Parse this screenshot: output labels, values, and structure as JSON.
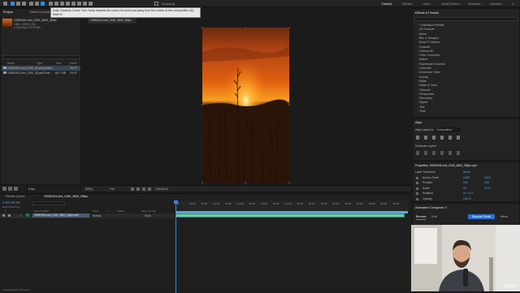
{
  "toolbar": {
    "tooltip": "Dolly Towards Cursor Tool: Dolly towards the cursor hit point and away from the center of the composition (D) Shift+D",
    "snapping_label": "Snapping",
    "workspaces": [
      "Default",
      "Review",
      "Learn",
      "Small Screen",
      "Standard",
      "Libraries"
    ]
  },
  "project": {
    "tabs": [
      "Project",
      "Effect Controls"
    ],
    "comp_name": "19082404-uhd_2160_3840_30fps",
    "info_lines": [
      "1080 x 1920 (1.00)",
      "∆ 0;00;38;14, 29.97 fps"
    ],
    "search_placeholder": "",
    "columns": [
      "Name",
      "Type",
      "Size",
      "Frame Ra"
    ],
    "items": [
      {
        "name": "19082404-uhd_2160_3840_30fps",
        "type": "Composition",
        "size": "",
        "rate": "29.97"
      },
      {
        "name": "19082404-uhd_2160_3840_30fps.mp4",
        "type": "QuickTime",
        "size": "66.7 MB",
        "rate": "29.97"
      }
    ],
    "footer_bpc": "8 bpc"
  },
  "viewer": {
    "tab_label": "19082404-uhd_2160_3840_30fps",
    "zoom": "(50%)",
    "quality": "Full",
    "timecode": "0;00;00;00"
  },
  "effects": {
    "title": "Effects & Presets",
    "search_placeholder": "",
    "items": [
      "* Animation Presets",
      "3D Channel",
      "Audio",
      "Blur & Sharpen",
      "Boris FX Mocha",
      "Channel",
      "Cinema 4D",
      "Color Correction",
      "Distort",
      "Expression Controls",
      "Generate",
      "Immersive Video",
      "Keying",
      "Matte",
      "Noise & Grain",
      "Obsolete",
      "Perspective",
      "Simulation",
      "Stylize",
      "Text",
      "Time"
    ]
  },
  "align": {
    "title": "Align",
    "align_to_label": "Align Layers to:",
    "align_to_value": "Composition",
    "distribute_label": "Distribute Layers:"
  },
  "properties": {
    "title": "Properties: 19082404-uhd_2160_3840_30fps.mp4",
    "section": "Layer Transform",
    "reset": "Reset",
    "rows": [
      {
        "label": "Anchor Point",
        "v1": "1080",
        "v2": "1920"
      },
      {
        "label": "Position",
        "v1": "540",
        "v2": "960"
      },
      {
        "label": "Scale",
        "v1": "50",
        "v2": "50 %"
      },
      {
        "label": "Rotation",
        "v1": "0x +0.0°",
        "v2": ""
      },
      {
        "label": "Opacity",
        "v1": "100 %",
        "v2": ""
      }
    ]
  },
  "annotation": {
    "title": "Animation Composer 3",
    "tabs": [
      "Browse",
      "Edit"
    ],
    "discover_button": "Discover Packs",
    "menu": "Menu",
    "watermark": "Udemy"
  },
  "timeline": {
    "render_queue_tab": "Render Queue",
    "comp_tab": "19082404-uhd_2160_3840_30fps",
    "timecode": "0;00;00;00",
    "fps": "00000 (29.97 fps)",
    "layer_columns": [
      "#",
      "Source Name",
      "Mode",
      "T",
      "TrkMat",
      "Parent & Link"
    ],
    "layer": {
      "index": "1",
      "name": "19082404-uhd_2160_3840_30fps.mp4",
      "mode": "Normal",
      "parent": "None"
    },
    "ruler": [
      "0f",
      "00:15f",
      "01:00f",
      "01:15f",
      "02:00f",
      "02:15f",
      "03:00f",
      "03:15f",
      "04:00f",
      "04:15f",
      "05:00f",
      "05:15f",
      "06:00f",
      "06:15f",
      "07:00f",
      "07:15f",
      "08:00f",
      "08:15f",
      "09:00f"
    ],
    "footer_label": "Frame Render Time  0ms"
  },
  "colors": {
    "accent": "#2d8ceb",
    "layer_bar": "#2e6e5a",
    "timeline_green": "#6fc6a8",
    "sunset_top": "#e06010",
    "sunset_mid": "#f7a020"
  }
}
